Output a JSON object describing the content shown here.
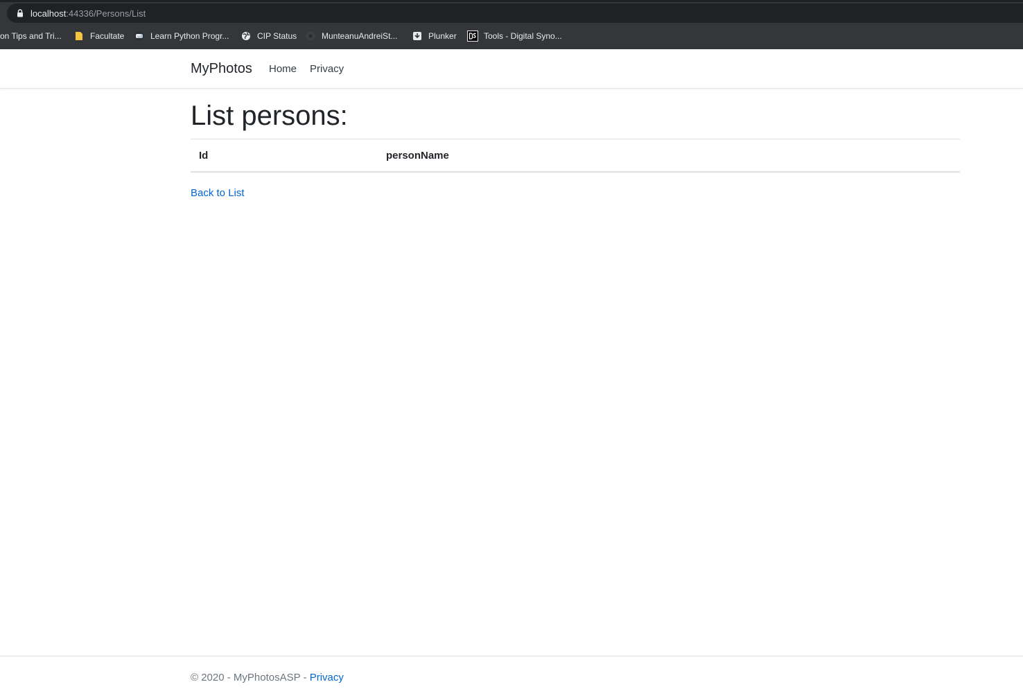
{
  "browser": {
    "url_host": "localhost",
    "url_rest": ":44336/Persons/List",
    "bookmarks": [
      {
        "label": "on Tips and Tri...",
        "icon": "none"
      },
      {
        "label": "Facultate",
        "icon": "folder-icon",
        "color": "#f6c342"
      },
      {
        "label": "Learn Python Progr...",
        "icon": "python-icon"
      },
      {
        "label": "CIP Status",
        "icon": "globe-icon"
      },
      {
        "label": "MunteanuAndreiSt...",
        "icon": "github-icon"
      },
      {
        "label": "Plunker",
        "icon": "plunker-icon"
      },
      {
        "label": "Tools - Digital Syno...",
        "icon": "ds-icon"
      }
    ]
  },
  "nav": {
    "brand": "MyPhotos",
    "links": [
      "Home",
      "Privacy"
    ]
  },
  "main": {
    "title": "List persons:",
    "table": {
      "headers": [
        "Id",
        "personName"
      ],
      "rows": []
    },
    "back_link": "Back to List"
  },
  "footer": {
    "text": "© 2020 - MyPhotosASP - ",
    "link": "Privacy"
  },
  "colors": {
    "link": "#0366d6",
    "chrome_bg": "#35363a",
    "omnibox_bg": "#202124"
  }
}
